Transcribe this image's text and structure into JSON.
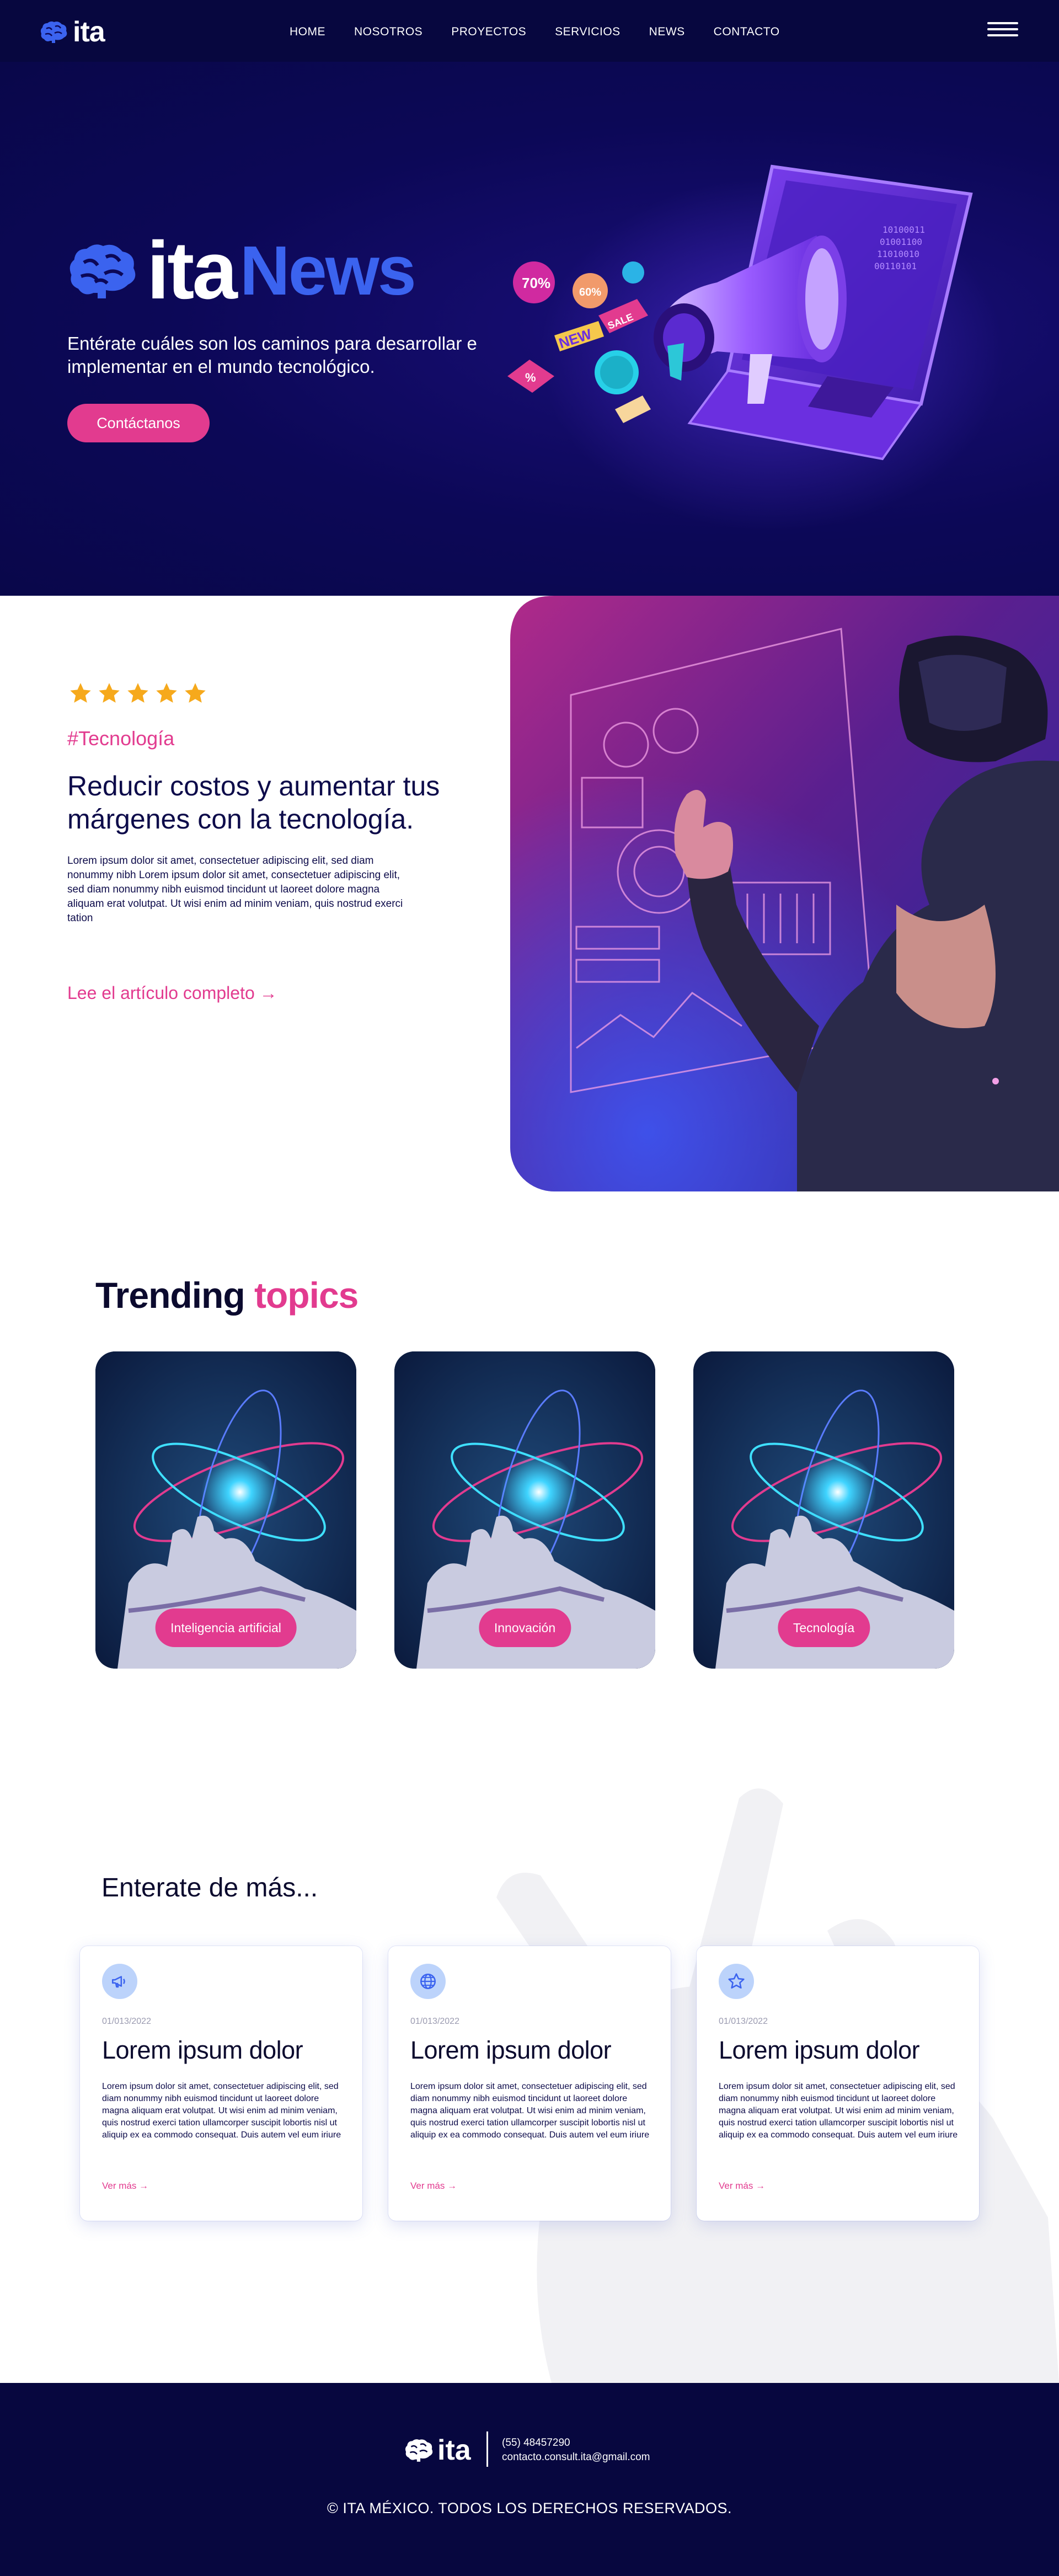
{
  "brand": {
    "name": "ita",
    "news_word": "News"
  },
  "nav": {
    "items": [
      "HOME",
      "NOSOTROS",
      "PROYECTOS",
      "SERVICIOS",
      "NEWS",
      "CONTACTO"
    ],
    "menu_icon": "hamburger-menu-icon"
  },
  "hero": {
    "subtitle": "Entérate cuáles son los caminos para desarrollar e implementar en el mundo tecnológico.",
    "cta_label": "Contáctanos",
    "badges": {
      "pct70": "70%",
      "pct60": "60%",
      "sale": "SALE",
      "new": "NEW",
      "pct": "%"
    }
  },
  "article": {
    "rating": 5,
    "tag": "#Tecnología",
    "title": "Reducir costos y aumentar tus márgenes con la tecnología.",
    "body": "Lorem ipsum dolor sit amet, consectetuer adipiscing elit, sed diam nonummy nibh Lorem ipsum dolor sit amet, consectetuer adipiscing elit, sed diam nonummy nibh euismod tincidunt ut laoreet dolore magna aliquam erat volutpat. Ut wisi enim ad minim veniam, quis nostrud exerci tation",
    "link_label": "Lee el artículo completo →"
  },
  "trending": {
    "title_a": "Trending",
    "title_b": "topics",
    "cards": [
      {
        "label": "Inteligencia artificial"
      },
      {
        "label": "Innovación"
      },
      {
        "label": "Tecnología"
      }
    ]
  },
  "more": {
    "title": "Enterate de más...",
    "cards": [
      {
        "icon": "megaphone-icon",
        "date": "01/013/2022",
        "title": "Lorem ipsum dolor",
        "text": "Lorem ipsum dolor sit amet, consectetuer adipiscing elit, sed diam nonummy nibh euismod tincidunt ut laoreet dolore magna aliquam erat volutpat. Ut wisi enim ad minim veniam, quis nostrud exerci tation ullamcorper suscipit lobortis nisl ut aliquip ex ea commodo consequat. Duis autem vel eum iriure",
        "link": "Ver más →"
      },
      {
        "icon": "globe-icon",
        "date": "01/013/2022",
        "title": "Lorem ipsum dolor",
        "text": "Lorem ipsum dolor sit amet, consectetuer adipiscing elit, sed diam nonummy nibh euismod tincidunt ut laoreet dolore magna aliquam erat volutpat. Ut wisi enim ad minim veniam, quis nostrud exerci tation ullamcorper suscipit lobortis nisl ut aliquip ex ea commodo consequat. Duis autem vel eum iriure",
        "link": "Ver más →"
      },
      {
        "icon": "star-icon",
        "date": "01/013/2022",
        "title": "Lorem ipsum dolor",
        "text": "Lorem ipsum dolor sit amet, consectetuer adipiscing elit, sed diam nonummy nibh euismod tincidunt ut laoreet dolore magna aliquam erat volutpat. Ut wisi enim ad minim veniam, quis nostrud exerci tation ullamcorper suscipit lobortis nisl ut aliquip ex ea commodo consequat. Duis autem vel eum iriure",
        "link": "Ver más →"
      }
    ]
  },
  "footer": {
    "phone": "(55) 48457290",
    "email": "contacto.consult.ita@gmail.com",
    "copyright": "© ITA MÉXICO. TODOS LOS DERECHOS RESERVADOS."
  },
  "colors": {
    "navy": "#07073f",
    "accent_pink": "#e23b8f",
    "brand_blue": "#3b63ef",
    "star": "#f6a91c"
  }
}
